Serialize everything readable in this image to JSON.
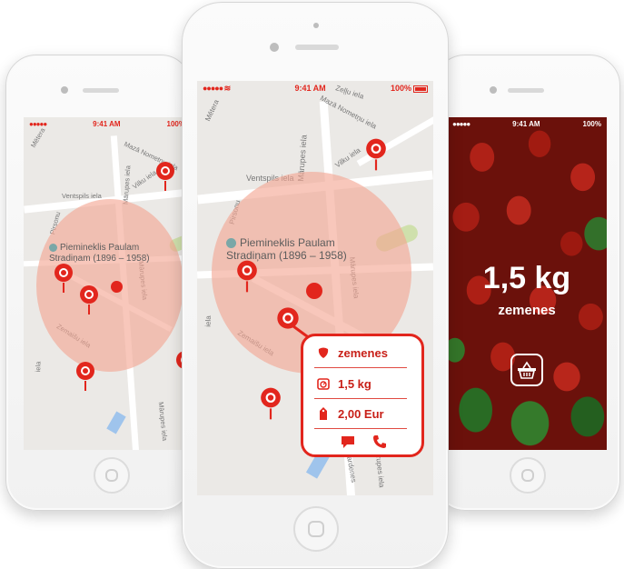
{
  "colors": {
    "accent": "#e2261d",
    "circle": "#f4a591",
    "map_bg": "#ebe9e6"
  },
  "status": {
    "time": "9:41 AM",
    "battery": "100%"
  },
  "map": {
    "streets": {
      "mazais_nometnu": "Mazā Nometņu iela",
      "zellu": "Zeļļu iela",
      "metera": "Mētera",
      "marupes": "Mārupes iela",
      "vilku": "Vilku iela",
      "ventspils": "Ventspils iela",
      "pirsonu": "Pirsonu",
      "zemaisu": "Zemaišu iela",
      "gardenes": "Gardenes",
      "iela": "iela"
    },
    "landmark_line1": "Piemineklis Paulam",
    "landmark_line2": "Stradiņam (1896 – 1958)"
  },
  "popup": {
    "product": "zemenes",
    "weight": "1,5 kg",
    "price": "2,00 Eur"
  },
  "detail": {
    "quantity": "1,5 kg",
    "product": "zemenes"
  }
}
